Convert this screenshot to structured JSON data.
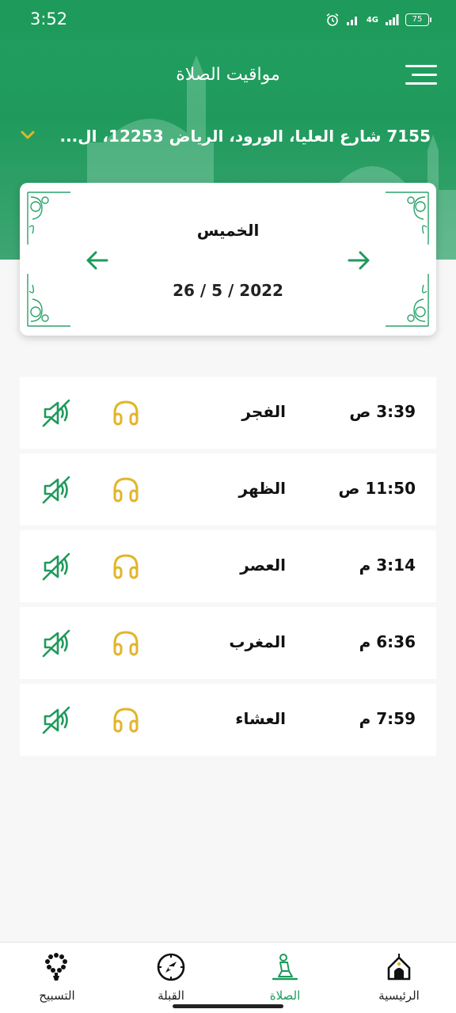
{
  "status_bar": {
    "time": "3:52",
    "network_label": "4G",
    "battery": "75"
  },
  "header": {
    "title": "مواقيت الصلاة",
    "menu_icon": "hamburger-menu-icon",
    "location": "7155 شارع العليا، الورود، الرياض 12253، ال...",
    "location_dropdown_icon": "chevron-down-icon"
  },
  "date_card": {
    "day_name": "الخميس",
    "date": "26 / 5 / 2022",
    "prev_icon": "arrow-left-icon",
    "next_icon": "arrow-right-icon"
  },
  "prayers": [
    {
      "name": "الفجر",
      "time": "3:39 ص"
    },
    {
      "name": "الظهر",
      "time": "11:50 ص"
    },
    {
      "name": "العصر",
      "time": "3:14 م"
    },
    {
      "name": "المغرب",
      "time": "6:36 م"
    },
    {
      "name": "العشاء",
      "time": "7:59 م"
    }
  ],
  "bottom_nav": [
    {
      "label": "الرئيسية",
      "icon": "mosque-home-icon",
      "active": false
    },
    {
      "label": "الصلاة",
      "icon": "praying-person-icon",
      "active": true
    },
    {
      "label": "القبلة",
      "icon": "compass-icon",
      "active": false
    },
    {
      "label": "التسبيح",
      "icon": "prayer-beads-icon",
      "active": false
    }
  ],
  "colors": {
    "brand_green": "#1f9a5c",
    "accent_gold": "#e2b52a",
    "background": "#f7f7f7"
  }
}
